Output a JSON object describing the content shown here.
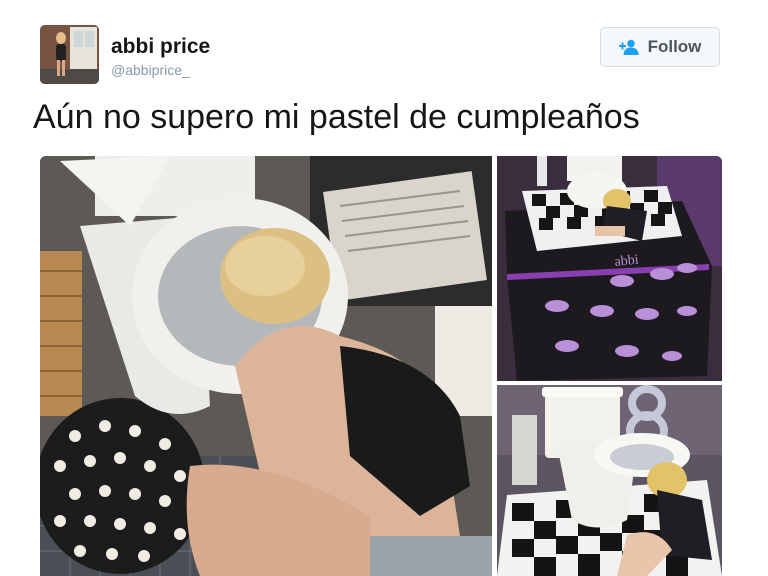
{
  "user": {
    "name": "abbi price",
    "handle": "@abbiprice_"
  },
  "follow_button": {
    "label": "Follow",
    "icon": "add-user-icon"
  },
  "tweet": {
    "text": "Aún no supero mi pastel de cumpleaños"
  },
  "media": {
    "photos": [
      "woman-leaning-into-toilet-photo",
      "toilet-cake-top-view-photo",
      "toilet-cake-side-view-photo"
    ],
    "cake_lettering": "abbi"
  },
  "colors": {
    "text": "#14171a",
    "handle": "#8899a6",
    "button_bg": "#f5f8fa",
    "accent": "#1da1f2"
  }
}
